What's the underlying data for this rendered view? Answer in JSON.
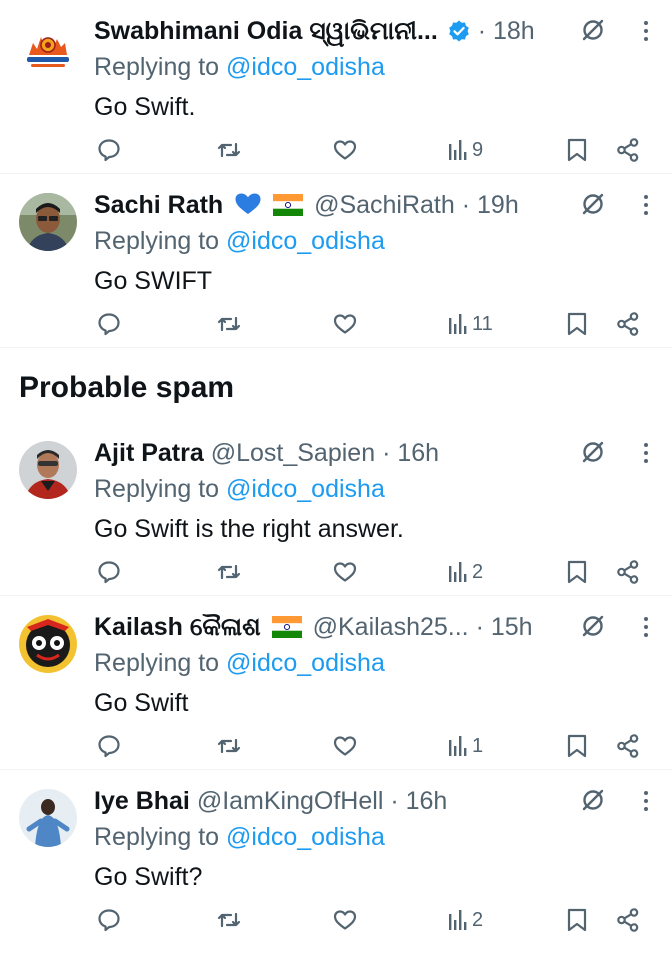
{
  "tweets_top": [
    {
      "name": "Swabhimani Odia ସ୍ୱାଭିମାନୀ...",
      "handle": "",
      "time": "· 18h",
      "reply_prefix": "Replying to ",
      "reply_handle": "@idco_odisha",
      "text": "Go Swift.",
      "views": "9",
      "avatar": "swabhimani-logo"
    },
    {
      "name": "Sachi Rath",
      "handle": "@SachiRath",
      "time": "· 19h",
      "reply_prefix": "Replying to ",
      "reply_handle": "@idco_odisha",
      "text": "Go SWIFT",
      "views": "11",
      "avatar": "sachi-photo"
    }
  ],
  "spam_heading": "Probable spam",
  "tweets_spam": [
    {
      "name": "Ajit Patra",
      "handle": "@Lost_Sapien",
      "time": "· 16h",
      "reply_prefix": "Replying to ",
      "reply_handle": "@idco_odisha",
      "text": "Go Swift is the right answer.",
      "views": "2",
      "avatar": "ajit-photo"
    },
    {
      "name": "Kailash କୈଳାଶ",
      "handle": "@Kailash25...",
      "time": "· 15h",
      "reply_prefix": "Replying to ",
      "reply_handle": "@idco_odisha",
      "text": "Go Swift",
      "views": "1",
      "avatar": "jagannath-image"
    },
    {
      "name": "Iye Bhai",
      "handle": "@IamKingOfHell",
      "time": "· 16h",
      "reply_prefix": "Replying to ",
      "reply_handle": "@idco_odisha",
      "text": "Go Swift?",
      "views": "2",
      "avatar": "iye-photo"
    }
  ],
  "icons": [
    "reply-icon",
    "retweet-icon",
    "like-icon",
    "views-icon",
    "bookmark-icon",
    "share-icon",
    "mute-icon",
    "more-icon",
    "verified-icon",
    "india-flag-icon",
    "blue-heart-icon"
  ],
  "colors": {
    "link": "#1d9bf0",
    "secondary": "#536471",
    "text": "#0f1419",
    "verified": "#1d9bf0"
  }
}
